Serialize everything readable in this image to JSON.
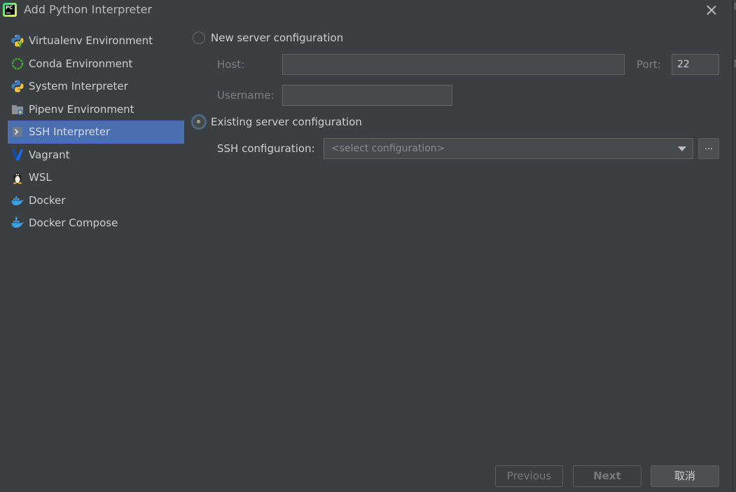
{
  "window": {
    "title": "Add Python Interpreter",
    "app_icon_text": "PC"
  },
  "sidebar": {
    "items": [
      {
        "label": "Virtualenv Environment",
        "icon": "python-virtualenv-icon"
      },
      {
        "label": "Conda Environment",
        "icon": "conda-icon"
      },
      {
        "label": "System Interpreter",
        "icon": "python-icon"
      },
      {
        "label": "Pipenv Environment",
        "icon": "pipenv-icon"
      },
      {
        "label": "SSH Interpreter",
        "icon": "ssh-terminal-icon",
        "selected": true
      },
      {
        "label": "Vagrant",
        "icon": "vagrant-icon"
      },
      {
        "label": "WSL",
        "icon": "linux-tux-icon"
      },
      {
        "label": "Docker",
        "icon": "docker-icon"
      },
      {
        "label": "Docker Compose",
        "icon": "docker-compose-icon"
      }
    ]
  },
  "new_server": {
    "label": "New server configuration",
    "selected": false,
    "host_label": "Host:",
    "host_value": "",
    "port_label": "Port:",
    "port_value": "22",
    "username_label": "Username:",
    "username_value": ""
  },
  "existing_server": {
    "label": "Existing server configuration",
    "selected": true,
    "ssh_config_label": "SSH configuration:",
    "ssh_config_placeholder": "<select configuration>",
    "browse_label": "..."
  },
  "buttons": {
    "previous": "Previous",
    "next": "Next",
    "cancel": "取消"
  },
  "colors": {
    "background": "#3c3f41",
    "selection": "#4b6eaf",
    "text": "#bbbbbb"
  }
}
